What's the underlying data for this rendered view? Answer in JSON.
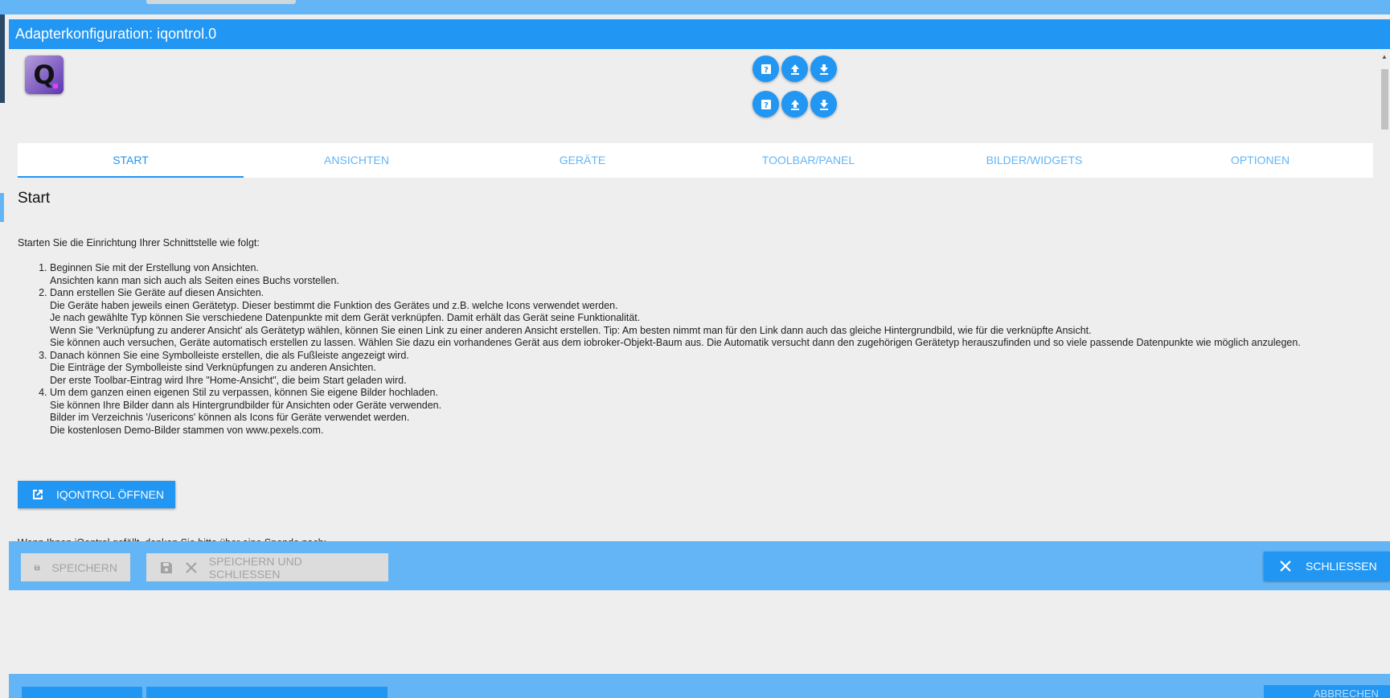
{
  "dialog": {
    "title": "Adapterkonfiguration: iqontrol.0"
  },
  "logo": {
    "letter": "Q"
  },
  "tabs": [
    "START",
    "ANSICHTEN",
    "GERÄTE",
    "TOOLBAR/PANEL",
    "BILDER/WIDGETS",
    "OPTIONEN"
  ],
  "start": {
    "heading": "Start",
    "intro": "Starten Sie die Einrichtung Ihrer Schnittstelle wie folgt:",
    "steps": [
      {
        "lead": "Beginnen Sie mit der Erstellung von Ansichten.",
        "lines": [
          "Ansichten kann man sich auch als Seiten eines Buchs vorstellen."
        ]
      },
      {
        "lead": "Dann erstellen Sie Geräte auf diesen Ansichten.",
        "lines": [
          "Die Geräte haben jeweils einen Gerätetyp. Dieser bestimmt die Funktion des Gerätes und z.B. welche Icons verwendet werden.",
          "Je nach gewählte Typ können Sie verschiedene Datenpunkte mit dem Gerät verknüpfen. Damit erhält das Gerät seine Funktionalität.",
          "Wenn Sie 'Verknüpfung zu anderer Ansicht' als Gerätetyp wählen, können Sie einen Link zu einer anderen Ansicht erstellen. Tip: Am besten nimmt man für den Link dann auch das gleiche Hintergrundbild, wie für die verknüpfte Ansicht.",
          "Sie können auch versuchen, Geräte automatisch erstellen zu lassen. Wählen Sie dazu ein vorhandenes Gerät aus dem iobroker-Objekt-Baum aus. Die Automatik versucht dann den zugehörigen Gerätetyp herauszufinden und so viele passende Datenpunkte wie möglich anzulegen."
        ]
      },
      {
        "lead": "Danach können Sie eine Symbolleiste erstellen, die als Fußleiste angezeigt wird.",
        "lines": [
          "Die Einträge der Symbolleiste sind Verknüpfungen zu anderen Ansichten.",
          "Der erste Toolbar-Eintrag wird Ihre \"Home-Ansicht\", die beim Start geladen wird."
        ]
      },
      {
        "lead": "Um dem ganzen einen eigenen Stil zu verpassen, können Sie eigene Bilder hochladen.",
        "lines": [
          "Sie können Ihre Bilder dann als Hintergrundbilder für Ansichten oder Geräte verwenden.",
          "Bilder im Verzeichnis '/usericons' können als Icons für Geräte verwendet werden.",
          "Die kostenlosen Demo-Bilder stammen von www.pexels.com."
        ]
      }
    ],
    "open_button": "IQONTROL ÖFFNEN",
    "donate_text": "Wenn Ihnen iQontrol gefällt, denken Sie bitte über eine Spende nach:"
  },
  "actions": {
    "save": "SPEICHERN",
    "save_close": "SPEICHERN UND SCHLIESSEN",
    "close": "SCHLIESSEN"
  },
  "bottom": {
    "cancel": "ABBRECHEN"
  },
  "colors": {
    "primary": "#2196f3",
    "light": "#64b5f6",
    "background": "#eeeeee"
  }
}
